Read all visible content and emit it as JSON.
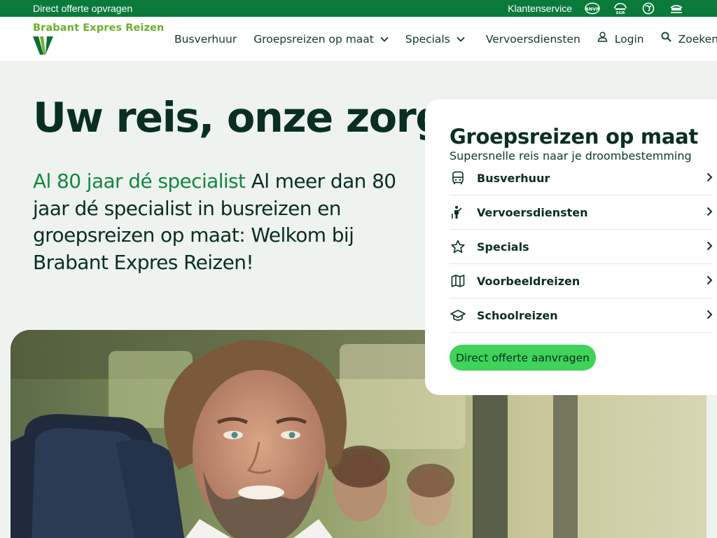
{
  "topbar": {
    "quote_link": "Direct offerte opvragen",
    "customer_service": "Klantenservice",
    "certifications": [
      "anvr-certificate-icon",
      "sgr-certificate-icon",
      "globe-certificate-icon",
      "busrie-certificate-icon"
    ]
  },
  "header": {
    "logo_text": "Brabant Expres Reizen",
    "nav": {
      "busverhuur": "Busverhuur",
      "groepsreizen": "Groepsreizen op maat",
      "specials": "Specials",
      "vervoersdiensten": "Vervoersdiensten",
      "login": "Login",
      "zoeken": "Zoeken"
    }
  },
  "hero": {
    "title": "Uw reis, onze zorg",
    "accent": "Al 80 jaar dé specialist",
    "text": " Al meer dan 80 jaar dé specialist in busreizen en groepsreizen op maat: Welkom bij Brabant Expres Reizen!"
  },
  "card": {
    "title": "Groepsreizen op maat",
    "subtitle": "Supersnelle reis naar je droombestemming",
    "items": [
      {
        "label": "Busverhuur",
        "icon": "bus-icon"
      },
      {
        "label": "Vervoersdiensten",
        "icon": "person-flag-icon"
      },
      {
        "label": "Specials",
        "icon": "star-icon"
      },
      {
        "label": "Voorbeeldreizen",
        "icon": "map-icon"
      },
      {
        "label": "Schoolreizen",
        "icon": "graduation-cap-icon"
      }
    ],
    "cta": "Direct offerte aanvragen"
  },
  "colors": {
    "topbar": "#0a7a3a",
    "brand_green": "#6ab02c",
    "accent_text": "#14873f",
    "cta": "#3fd35a",
    "dark_text": "#0a2e22",
    "hero_bg": "#eef3ef"
  }
}
